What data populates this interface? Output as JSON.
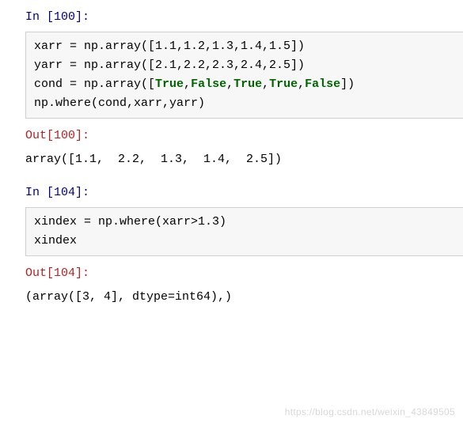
{
  "cells": [
    {
      "in_prompt": "In  [100]:",
      "code_lines": [
        "xarr = np.array([1.1,1.2,1.3,1.4,1.5])",
        "yarr = np.array([2.1,2.2,2.3,2.4,2.5])",
        [
          "cond = np.array([",
          {
            "t": "True",
            "c": "kw-true"
          },
          ",",
          {
            "t": "False",
            "c": "kw-false"
          },
          ",",
          {
            "t": "True",
            "c": "kw-true"
          },
          ",",
          {
            "t": "True",
            "c": "kw-true"
          },
          ",",
          {
            "t": "False",
            "c": "kw-false"
          },
          "])"
        ],
        "np.where(cond,xarr,yarr)"
      ],
      "out_prompt": "Out[100]:",
      "output": "array([1.1,  2.2,  1.3,  1.4,  2.5])"
    },
    {
      "in_prompt": "In  [104]:",
      "code_lines": [
        "xindex = np.where(xarr>1.3)",
        "xindex"
      ],
      "out_prompt": "Out[104]:",
      "output": "(array([3, 4], dtype=int64),)"
    }
  ],
  "watermark": "https://blog.csdn.net/weixin_43849505"
}
